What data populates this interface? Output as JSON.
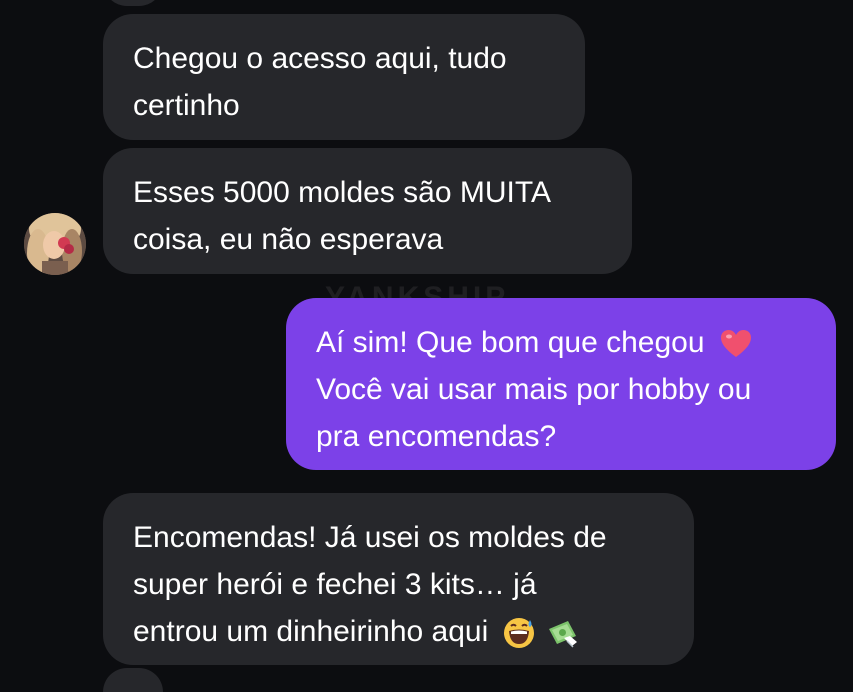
{
  "conversation": {
    "messages": [
      {
        "sender": "contact",
        "lines": [
          "Chegou o acesso aqui, tudo",
          "certinho"
        ]
      },
      {
        "sender": "contact",
        "lines": [
          "Esses 5000 moldes são MUITA",
          "coisa, eu não esperava"
        ],
        "has_avatar": true
      },
      {
        "sender": "me",
        "lines": [
          "Aí sim! Que bom que chegou",
          "Você vai usar mais por hobby ou",
          "pra encomendas?"
        ],
        "emojis": [
          "heart-emoji"
        ]
      },
      {
        "sender": "contact",
        "lines": [
          "Encomendas! Já usei os moldes de",
          "super herói e fechei 3 kits… já",
          "entrou um dinheirinho aqui"
        ],
        "emojis": [
          "grinning-sweat-emoji",
          "money-with-wings-emoji"
        ]
      }
    ]
  },
  "watermark": {
    "text": "YANKSHIP"
  },
  "colors": {
    "background": "#0c0d10",
    "incoming_bubble": "#26272b",
    "outgoing_bubble": "#7c41e8",
    "text": "#ffffff"
  }
}
